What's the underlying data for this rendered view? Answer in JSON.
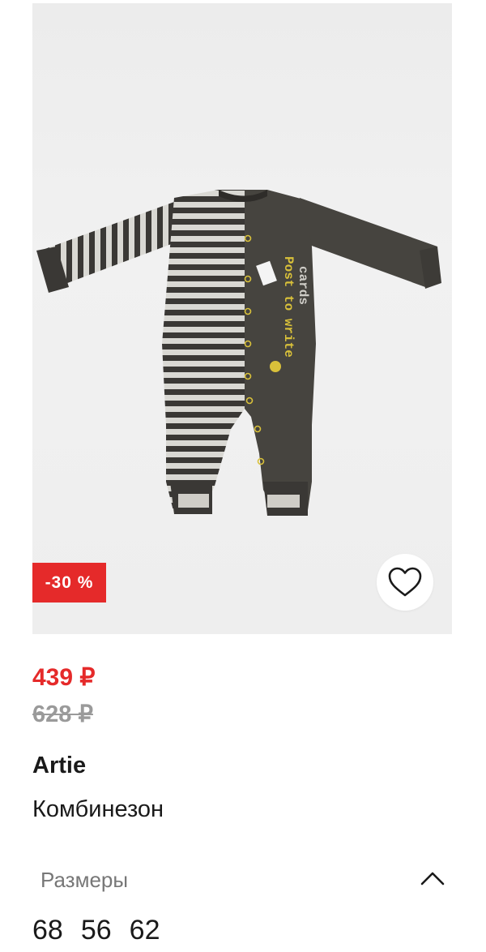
{
  "product": {
    "discount_badge": "-30 %",
    "price_current": "439 ₽",
    "price_old": "628 ₽",
    "brand": "Artie",
    "name": "Комбинезон"
  },
  "image_print_text": "Post to write cards",
  "sizes": {
    "label": "Размеры",
    "options": [
      "68",
      "56",
      "62"
    ]
  },
  "colors": {
    "accent": "#e52a2a",
    "old_price": "#9a9a9a",
    "garment_dark": "#46443f",
    "garment_light": "#d9d8d3",
    "print_yellow": "#d9c13a"
  },
  "icons": {
    "favorite": "heart-outline-icon",
    "collapse": "chevron-up-icon"
  }
}
